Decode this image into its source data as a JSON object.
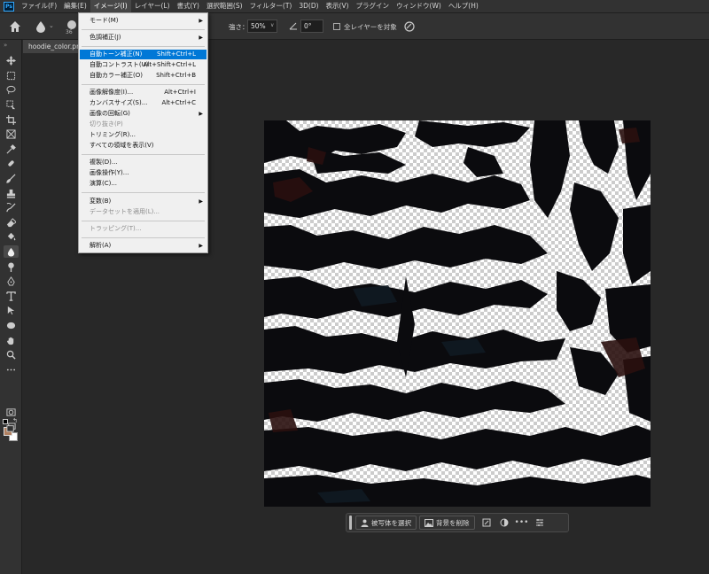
{
  "menubar": {
    "logo": "Ps",
    "items": [
      "ファイル(F)",
      "編集(E)",
      "イメージ(I)",
      "レイヤー(L)",
      "書式(Y)",
      "選択範囲(S)",
      "フィルター(T)",
      "3D(D)",
      "表示(V)",
      "プラグイン",
      "ウィンドウ(W)",
      "ヘルプ(H)"
    ],
    "active_index": 2
  },
  "options": {
    "brush_size": "36",
    "strength_label": "強さ：",
    "strength_value": "50%",
    "angle_value": "0°",
    "sample_all_label": "全レイヤーを対象"
  },
  "document": {
    "tab_title": "hoodie_color.png"
  },
  "image_menu": {
    "items": [
      {
        "label": "モード(M)",
        "shortcut": "",
        "submenu": true,
        "disabled": false,
        "highlight": false
      },
      {
        "label": "色調補正(J)",
        "shortcut": "",
        "submenu": true,
        "disabled": false,
        "highlight": false
      },
      {
        "label": "自動トーン補正(N)",
        "shortcut": "Shift+Ctrl+L",
        "submenu": false,
        "disabled": false,
        "highlight": true
      },
      {
        "label": "自動コントラスト(U)",
        "shortcut": "Alt+Shift+Ctrl+L",
        "submenu": false,
        "disabled": false,
        "highlight": false
      },
      {
        "label": "自動カラー補正(O)",
        "shortcut": "Shift+Ctrl+B",
        "submenu": false,
        "disabled": false,
        "highlight": false
      },
      {
        "label": "画像解像度(I)...",
        "shortcut": "Alt+Ctrl+I",
        "submenu": false,
        "disabled": false,
        "highlight": false
      },
      {
        "label": "カンバスサイズ(S)...",
        "shortcut": "Alt+Ctrl+C",
        "submenu": false,
        "disabled": false,
        "highlight": false
      },
      {
        "label": "画像の回転(G)",
        "shortcut": "",
        "submenu": true,
        "disabled": false,
        "highlight": false
      },
      {
        "label": "切り抜き(P)",
        "shortcut": "",
        "submenu": false,
        "disabled": true,
        "highlight": false
      },
      {
        "label": "トリミング(R)...",
        "shortcut": "",
        "submenu": false,
        "disabled": false,
        "highlight": false
      },
      {
        "label": "すべての領域を表示(V)",
        "shortcut": "",
        "submenu": false,
        "disabled": false,
        "highlight": false
      },
      {
        "label": "複製(D)...",
        "shortcut": "",
        "submenu": false,
        "disabled": false,
        "highlight": false
      },
      {
        "label": "画像操作(Y)...",
        "shortcut": "",
        "submenu": false,
        "disabled": false,
        "highlight": false
      },
      {
        "label": "演算(C)...",
        "shortcut": "",
        "submenu": false,
        "disabled": false,
        "highlight": false
      },
      {
        "label": "変数(B)",
        "shortcut": "",
        "submenu": true,
        "disabled": false,
        "highlight": false
      },
      {
        "label": "データセットを適用(L)...",
        "shortcut": "",
        "submenu": false,
        "disabled": true,
        "highlight": false
      },
      {
        "label": "トラッピング(T)...",
        "shortcut": "",
        "submenu": false,
        "disabled": true,
        "highlight": false
      },
      {
        "label": "解析(A)",
        "shortcut": "",
        "submenu": true,
        "disabled": false,
        "highlight": false
      }
    ]
  },
  "taskbar": {
    "select_subject": "被写体を選択",
    "remove_background": "背景を削除",
    "more": "•••"
  },
  "tools": [
    "move-tool",
    "marquee-tool",
    "lasso-tool",
    "object-select-tool",
    "crop-tool",
    "frame-tool",
    "eyedropper-tool",
    "healing-brush-tool",
    "brush-tool",
    "clone-stamp-tool",
    "history-brush-tool",
    "eraser-tool",
    "paint-bucket-tool",
    "blur-tool",
    "dodge-tool",
    "pen-tool",
    "type-tool",
    "path-select-tool",
    "ellipse-tool",
    "hand-tool",
    "zoom-tool",
    "more-tools"
  ],
  "colors": {
    "foreground": "#b08060",
    "background": "#ffffff",
    "accent": "#0078d7"
  }
}
